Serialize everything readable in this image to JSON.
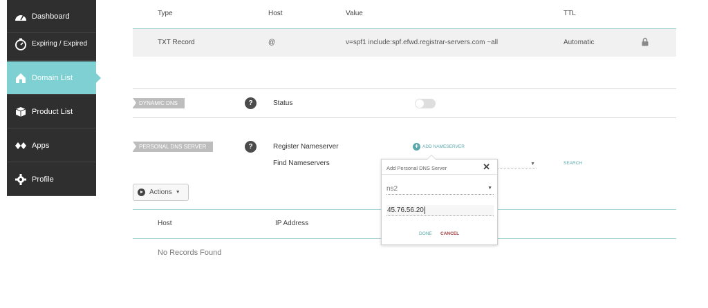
{
  "sidebar": {
    "items": [
      {
        "label": "Dashboard",
        "icon": "dashboard-gauge-icon"
      },
      {
        "label": "Expiring / Expired",
        "icon": "timer-icon"
      },
      {
        "label": "Domain List",
        "icon": "home-icon"
      },
      {
        "label": "Product List",
        "icon": "box-icon"
      },
      {
        "label": "Apps",
        "icon": "apps-icon"
      },
      {
        "label": "Profile",
        "icon": "gear-icon"
      }
    ]
  },
  "records": {
    "headers": [
      "Type",
      "Host",
      "Value",
      "TTL"
    ],
    "rows": [
      {
        "type": "TXT Record",
        "host": "@",
        "value": "v=spf1 include:spf.efwd.registrar-servers.com ~all",
        "ttl": "Automatic",
        "icon": "lock-icon"
      }
    ]
  },
  "dynamic_dns": {
    "tag": "DYNAMIC DNS",
    "help": "?",
    "status_label": "Status",
    "toggle": "off"
  },
  "personal_dns": {
    "tag": "PERSONAL DNS SERVER",
    "help": "?",
    "register_label": "Register Nameserver",
    "add_nameserver": "ADD NAMESERVER",
    "find_label": "Find Nameservers",
    "search": "SEARCH"
  },
  "actions": {
    "label": "Actions"
  },
  "ns_table": {
    "headers": [
      "Host",
      "IP Address"
    ],
    "empty": "No Records Found"
  },
  "popup": {
    "title": "Add Personal DNS Server",
    "close": "✕",
    "select_value": "ns2",
    "ip_value": "45.76.56.20",
    "done": "DONE",
    "cancel": "CANCEL"
  },
  "colors": {
    "sidebar": "#2f2f2f",
    "active": "#7fd0d2",
    "teal": "#5aa8ad",
    "cancel": "#a14040"
  }
}
